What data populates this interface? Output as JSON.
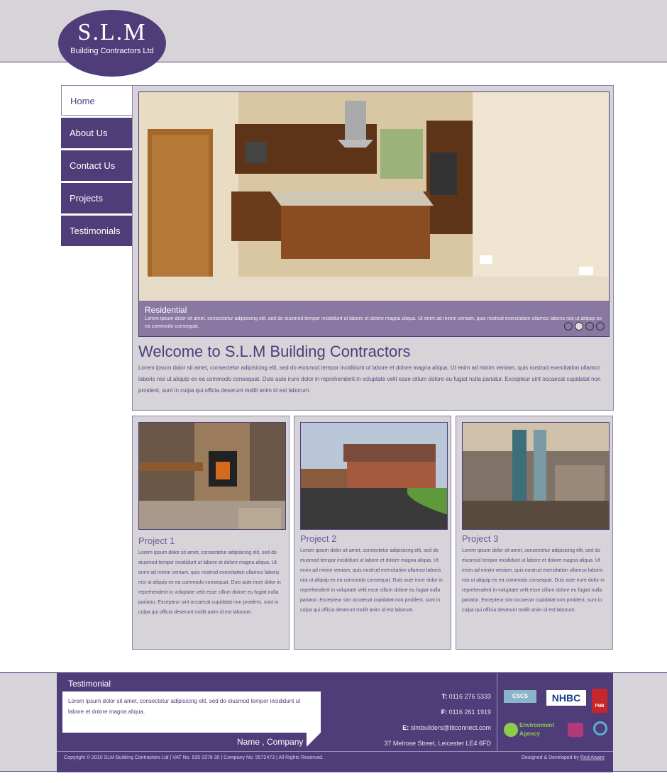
{
  "logo": {
    "big": "S.L.M",
    "small": "Building Contractors Ltd"
  },
  "nav": [
    {
      "label": "Home",
      "active": true
    },
    {
      "label": "About Us"
    },
    {
      "label": "Contact Us"
    },
    {
      "label": "Projects"
    },
    {
      "label": "Testimonials"
    }
  ],
  "hero": {
    "caption_title": "Residential",
    "caption_text": "Lorem ipsum dolor sit amet, consectetur adipisicing elit, sed do eiusmod tempor incididunt ut labore et dolore magna aliqua. Ut enim ad minim veniam, quis nostrud exercitation ullamco laboris nisi ut aliquip ex ea commodo consequat.",
    "dots": 4,
    "active_dot": 2
  },
  "welcome": {
    "title": "Welcome to S.L.M Building Contractors",
    "text": "Lorem ipsum dolor sit amet, consectetur adipisicing elit, sed do eiusmod tempor incididunt ut labore et dolore magna aliqua. Ut enim ad minim veniam, quis nostrud exercitation ullamco laboris nisi ut aliquip ex ea commodo consequat. Duis aute irure dolor in reprehenderit in voluptate velit esse cillum dolore eu fugiat nulla pariatur. Excepteur sint occaecat cupidatat non proident, sunt in culpa qui officia deserunt mollit anim id est laborum."
  },
  "projects": [
    {
      "title": "Project 1",
      "text": "Lorem ipsum dolor sit amet, consectetur adipisicing elit, sed do eiusmod tempor incididunt ut labore et dolore magna aliqua. Ut enim ad minim veniam, quis nostrud exercitation ullamco laboris nisi ut aliquip ex ea commodo consequat. Duis aute irure dolor in reprehenderit in voluptate velit esse cillum dolore eu fugiat nulla pariatur. Excepteur sint occaecat cupidatat non proident, sunt in culpa qui officia deserunt mollit anim id est laborum."
    },
    {
      "title": "Project 2",
      "text": "Lorem ipsum dolor sit amet, consectetur adipisicing elit, sed do eiusmod tempor incididunt ut labore et dolore magna aliqua. Ut enim ad minim veniam, quis nostrud exercitation ullamco laboris nisi ut aliquip ex ea commodo consequat. Duis aute irure dolor in reprehenderit in voluptate velit esse cillum dolore eu fugiat nulla pariatur. Excepteur sint occaecat cupidatat non proident, sunt in culpa qui officia deserunt mollit anim id est laborum."
    },
    {
      "title": "Project 3",
      "text": "Lorem ipsum dolor sit amet, consectetur adipisicing elit, sed do eiusmod tempor incididunt ut labore et dolore magna aliqua. Ut enim ad minim veniam, quis nostrud exercitation ullamco laboris nisi ut aliquip ex ea commodo consequat. Duis aute irure dolor in reprehenderit in voluptate velit esse cillum dolore eu fugiat nulla pariatur. Excepteur sint occaecat cupidatat non proident, sunt in culpa qui officia deserunt mollit anim id est laborum."
    }
  ],
  "footer": {
    "testimonial_heading": "Testimonial",
    "testimonial_text": "Lorem ipsum dolor sit amet, consectetur adipisicing elit, sed do eiusmod tempor incididunt ut labore et dolore magna aliqua.",
    "testimonial_name": "Name , Company",
    "tel_label": "T:",
    "tel": "0116 276 5333",
    "fax_label": "F:",
    "fax": "0116 261 1919",
    "email_label": "E:",
    "email": "slmbuilders@btconnect.com",
    "address": "37 Melrose Street, Leicester LE4 6FD",
    "logos": [
      "CSCS",
      "NHBC",
      "FMB",
      "Environment Agency"
    ],
    "copyright": "Copyright © 2010 SLM Building Contractors Ltd | VAT No. 935 0378 30 | Company No. 5572473 | All Rights Reserved.",
    "designed_prefix": "Designed & Developed by",
    "designed_by": "Red Aware"
  },
  "colors": {
    "brand": "#4f3d7a",
    "panel": "#d6d3d9"
  }
}
